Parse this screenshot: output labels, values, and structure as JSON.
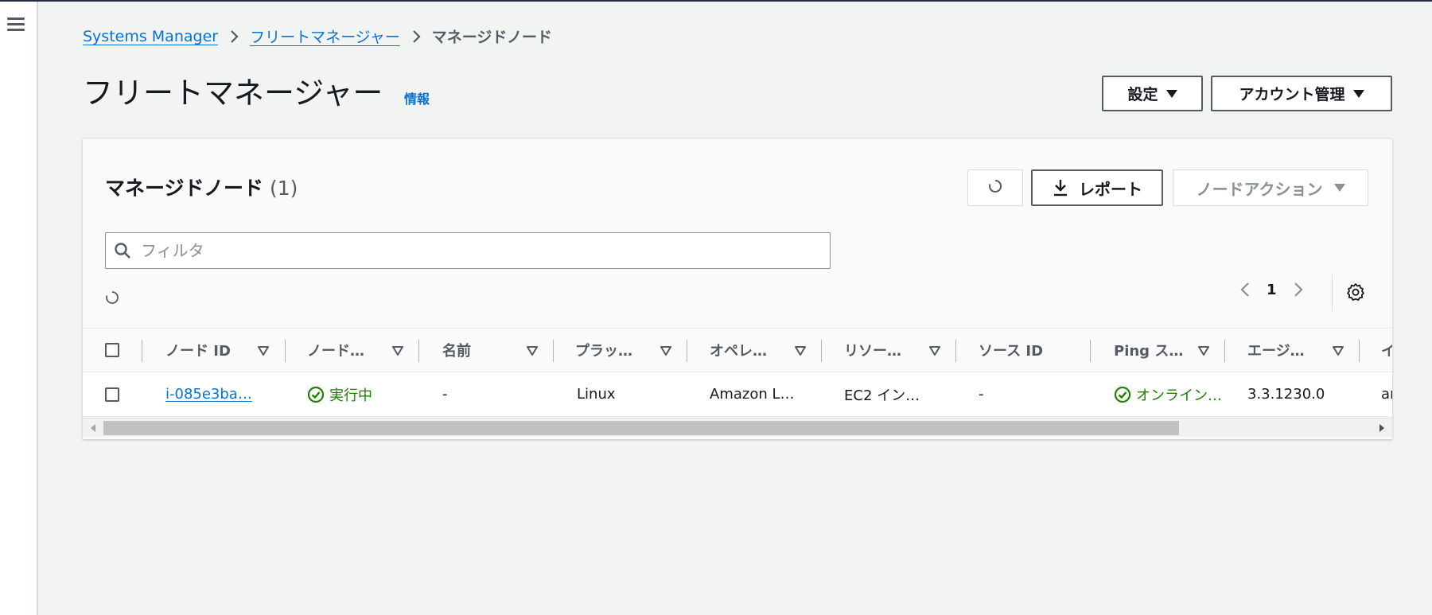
{
  "breadcrumb": {
    "items": [
      "Systems Manager",
      "フリートマネージャー"
    ],
    "current": "マネージドノード"
  },
  "page": {
    "title": "フリートマネージャー",
    "info": "情報"
  },
  "header_buttons": {
    "settings": "設定",
    "account": "アカウント管理"
  },
  "panel": {
    "title": "マネージドノード",
    "count": "(1)",
    "report_label": "レポート",
    "node_action_label": "ノードアクション"
  },
  "search": {
    "placeholder": "フィルタ",
    "value": ""
  },
  "pagination": {
    "current_page": "1"
  },
  "table": {
    "columns": [
      "ノード ID",
      "ノード…",
      "名前",
      "プラッ…",
      "オペレ…",
      "リソー…",
      "ソース ID",
      "Ping ス…",
      "エージ…",
      "イ"
    ],
    "rows": [
      {
        "node_id": "i-085e3ba…",
        "node_state": "実行中",
        "name": "-",
        "platform": "Linux",
        "os": "Amazon L…",
        "resource": "EC2 イン…",
        "source_id": "-",
        "ping": "オンライン…",
        "agent": "3.3.1230.0",
        "extra": "ar"
      }
    ]
  },
  "colors": {
    "link": "#0972d3",
    "success": "#1d8102",
    "background": "#f2f3f3"
  },
  "icons": [
    "menu-icon",
    "chevron-right-icon",
    "refresh-icon",
    "download-icon",
    "caret-down-icon",
    "search-icon",
    "spinner-icon",
    "chevron-left-icon",
    "gear-icon",
    "sort-icon",
    "check-circle-icon"
  ]
}
